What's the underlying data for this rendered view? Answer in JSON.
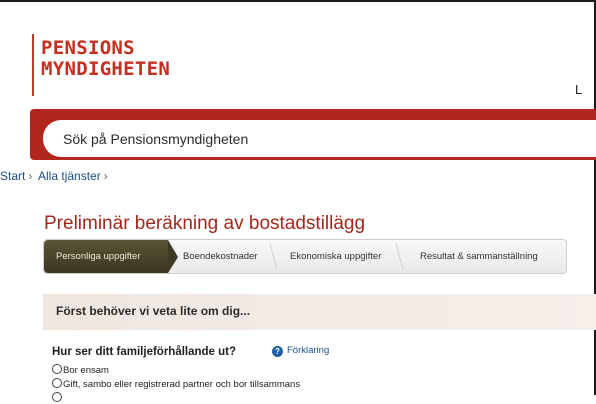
{
  "header": {
    "logo_line1": "PENSIONS",
    "logo_line2": "MYNDIGHETEN",
    "corner_letter": "L"
  },
  "search": {
    "placeholder": "Sök på Pensionsmyndigheten"
  },
  "breadcrumb": {
    "items": [
      "Start",
      "Alla tjänster"
    ],
    "separator": "›"
  },
  "page": {
    "title": "Preliminär beräkning av bostadstillägg"
  },
  "steps": [
    {
      "label": "Personliga uppgifter",
      "active": true
    },
    {
      "label": "Boendekostnader",
      "active": false
    },
    {
      "label": "Ekonomiska uppgifter",
      "active": false
    },
    {
      "label": "Resultat & sammanställning",
      "active": false
    }
  ],
  "info": {
    "text": "Först behöver vi veta lite om dig..."
  },
  "question": {
    "text": "Hur ser ditt familjeförhållande ut?",
    "help_label": "Förklaring",
    "options": [
      "Bor ensam",
      "Gift, sambo eller registrerad partner och bor tillsammans"
    ]
  },
  "colors": {
    "brand_red": "#c62f1f",
    "search_band": "#b3261e",
    "active_step": "#4a4429",
    "link_blue": "#1b4f8a"
  }
}
